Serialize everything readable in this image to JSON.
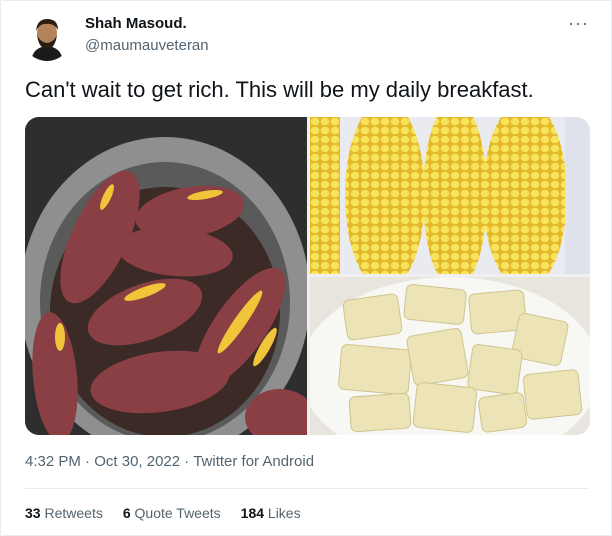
{
  "author": {
    "name": "Shah Masoud.",
    "handle": "@maumauveteran"
  },
  "more_icon": "ellipsis-icon",
  "tweet": {
    "text": "Can't wait to get rich. This will be my daily breakfast."
  },
  "media": {
    "images": [
      "sweet-potatoes",
      "boiled-corn",
      "boiled-cassava"
    ]
  },
  "meta": {
    "time": "4:32 PM",
    "sep1": " · ",
    "date": "Oct 30, 2022",
    "sep2": " · ",
    "source": "Twitter for Android"
  },
  "stats": [
    {
      "count": "33",
      "label": "Retweets"
    },
    {
      "count": "6",
      "label": "Quote Tweets"
    },
    {
      "count": "184",
      "label": "Likes"
    }
  ]
}
